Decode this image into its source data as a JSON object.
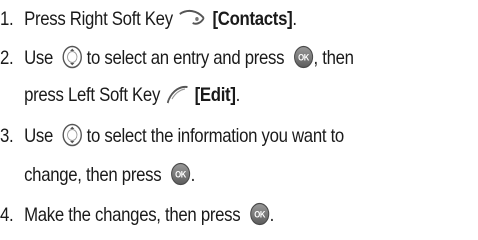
{
  "steps": [
    {
      "number": "1.",
      "text_a": "Press Right Soft Key",
      "key_label": "[Contacts]",
      "text_b": "."
    },
    {
      "number": "2.",
      "text_a": "Use",
      "text_b": "to select an entry and press",
      "text_c": ", then",
      "text_d": "press Left Soft Key",
      "key_label": "[Edit]",
      "text_e": "."
    },
    {
      "number": "3.",
      "text_a": "Use",
      "text_b": "to select the information you want to",
      "text_c": "change, then press",
      "text_d": "."
    },
    {
      "number": "4.",
      "text_a": "Make the changes, then press",
      "text_b": "."
    }
  ],
  "icons": {
    "right_soft_key": "right-soft-key-icon",
    "left_soft_key": "left-soft-key-icon",
    "nav_key": "navigation-key-icon",
    "ok_key": "ok-key-icon",
    "ok_label": "OK"
  }
}
